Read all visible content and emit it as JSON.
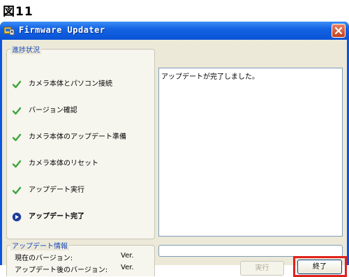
{
  "figure_label": "図11",
  "window": {
    "title": "Firmware Updater"
  },
  "progress_group": {
    "title": "進捗状況",
    "steps": [
      {
        "label": "カメラ本体とパソコン接続",
        "status": "done"
      },
      {
        "label": "バージョン確認",
        "status": "done"
      },
      {
        "label": "カメラ本体のアップデート準備",
        "status": "done"
      },
      {
        "label": "カメラ本体のリセット",
        "status": "done"
      },
      {
        "label": "アップデート実行",
        "status": "done"
      },
      {
        "label": "アップデート完了",
        "status": "current"
      }
    ]
  },
  "log": {
    "text": "アップデートが完了しました。"
  },
  "update_info": {
    "title": "アップデート情報",
    "current_version_label": "現在のバージョン:",
    "current_version_value": "Ver.",
    "after_version_label": "アップデート後のバージョン:",
    "after_version_value": "Ver."
  },
  "buttons": {
    "execute_label": "実行",
    "finish_label": "終了"
  },
  "colors": {
    "title_bar": "#0a55e0",
    "check": "#3aa63a",
    "highlight": "#e0211b"
  }
}
